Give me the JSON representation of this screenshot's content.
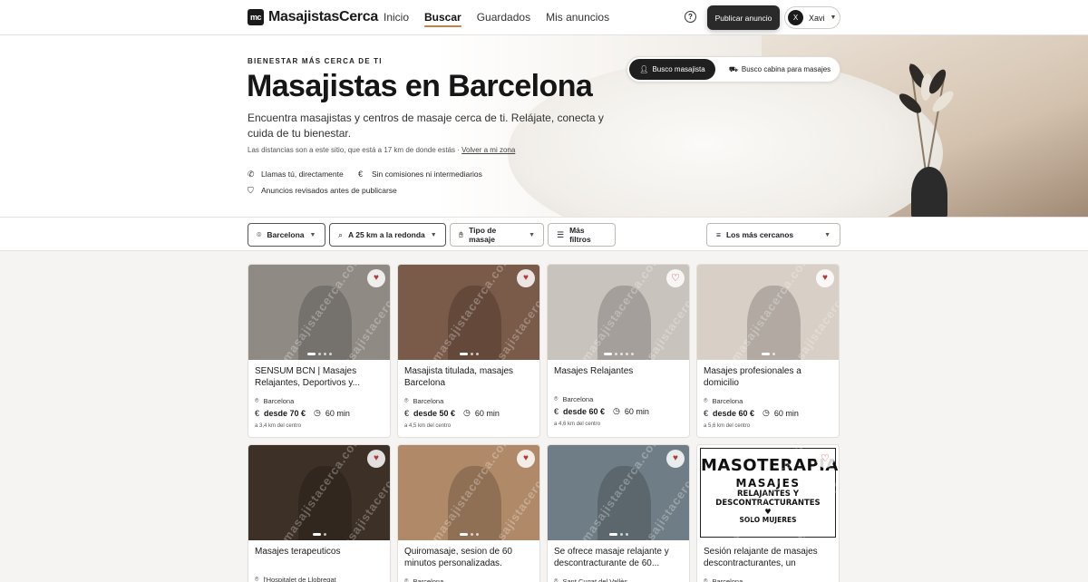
{
  "brand": {
    "mark": "mc",
    "name": "MasajistasCerca"
  },
  "nav": {
    "links": [
      "Inicio",
      "Buscar",
      "Guardados",
      "Mis anuncios"
    ],
    "active": "Buscar"
  },
  "header": {
    "help": "?",
    "publish": "Publicar anuncio",
    "user_initial": "X",
    "user_name": "Xavi"
  },
  "hero": {
    "eyebrow": "BIENESTAR MÁS CERCA DE TI",
    "title": "Masajistas en Barcelona",
    "lead": "Encuentra masajistas y centros de masaje cerca de ti. Relájate, conecta y cuida de tu bienestar.",
    "distance_note": "Las distancias son a este sitio, que está a 17 km de donde estás ·",
    "distance_link": "Volver a mi zona",
    "features": [
      "Llamas tú, directamente",
      "Sin comisiones ni intermediarios",
      "Anuncios revisados antes de publicarse"
    ],
    "toggle": {
      "primary": "Busco masajista",
      "secondary": "Busco cabina para masajes"
    }
  },
  "filters": {
    "city": "Barcelona",
    "radius": "A 25 km a la redonda",
    "type": "Tipo de masaje",
    "more": "Más filtros",
    "sort": "Los más cercanos"
  },
  "cards": [
    {
      "title": "SENSUM BCN | Masajes Relajantes, Deportivos y...",
      "location": "Barcelona",
      "price": "desde 70 €",
      "duration": "60 min",
      "distance": "a 3,4 km del centro",
      "favorite": true,
      "dots": 4,
      "active_dot": 0,
      "bg": "#8f8a84"
    },
    {
      "title": "Masajista titulada, masajes Barcelona",
      "location": "Barcelona",
      "price": "desde 50 €",
      "duration": "60 min",
      "distance": "a 4,5 km del centro",
      "favorite": true,
      "dots": 3,
      "active_dot": 0,
      "bg": "#7a5a48"
    },
    {
      "title": "Masajes Relajantes",
      "location": "Barcelona",
      "price": "desde 60 €",
      "duration": "60 min",
      "distance": "a 4,6 km del centro",
      "favorite": false,
      "dots": 5,
      "active_dot": 0,
      "bg": "#c8c3bc"
    },
    {
      "title": "Masajes profesionales a domicilio",
      "location": "Barcelona",
      "price": "desde 60 €",
      "duration": "60 min",
      "distance": "a 5,6 km del centro",
      "favorite": true,
      "dots": 2,
      "active_dot": 0,
      "bg": "#d8cfc6"
    },
    {
      "title": "Masajes terapeuticos",
      "location": "l'Hospitalet de Llobregat",
      "favorite": true,
      "dots": 2,
      "active_dot": 0,
      "bg": "#3d3026"
    },
    {
      "title": "Quiromasaje, sesion de 60 minutos personalizadas.",
      "location": "Barcelona",
      "favorite": true,
      "dots": 3,
      "active_dot": 0,
      "bg": "#b08968"
    },
    {
      "title": "Se ofrece masaje relajante y descontracturante de 60...",
      "location": "Sant Cugat del Vallès",
      "favorite": true,
      "dots": 3,
      "active_dot": 0,
      "bg": "#6f7e86"
    },
    {
      "title": "Sesión relajante de masajes descontracturantes, un espacio...",
      "location": "Barcelona",
      "favorite": false,
      "dots": 0,
      "active_dot": 0,
      "bg": "#ffffff",
      "poster": {
        "title": "MASOTERAPIA",
        "sub1": "MASAJES",
        "sub2": "RELAJANTES Y",
        "sub3": "DESCONTRACTURANTES",
        "heart": "♥",
        "sub4": "SOLO MUJERES"
      }
    }
  ],
  "watermark": "masajistacerca.com",
  "colors": {
    "accent": "#b8864b",
    "fav": "#b43a3a"
  }
}
